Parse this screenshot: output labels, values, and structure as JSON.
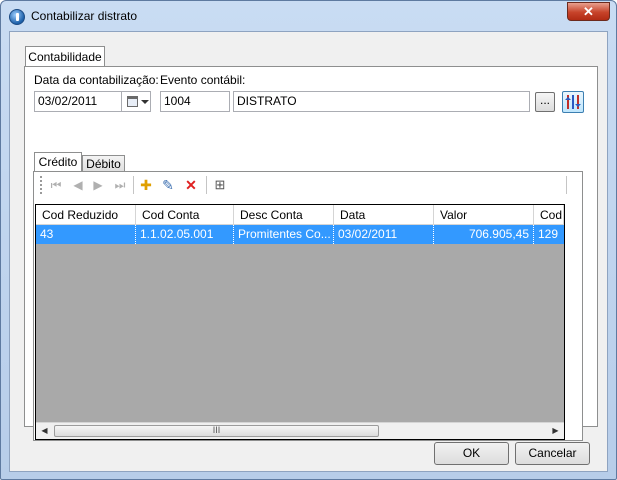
{
  "window": {
    "title": "Contabilizar distrato",
    "close_glyph": "✕"
  },
  "outer_tab": {
    "label": "Contabilidade"
  },
  "form": {
    "date_label": "Data da contabilização:",
    "date_value": "03/02/2011",
    "event_label": "Evento contábil:",
    "event_code": "1004",
    "event_desc": "DISTRATO",
    "lookup_label": "...",
    "lookup_icon": "ellipsis-icon",
    "tool_icon": "columns-settings-icon"
  },
  "tabs": [
    {
      "label": "Crédito",
      "active": true
    },
    {
      "label": "Débito",
      "active": false
    }
  ],
  "toolbar": {
    "first": "⏮",
    "prev": "◀",
    "next": "▶",
    "last": "⏭",
    "add": "✚",
    "edit": "✎",
    "delete": "✕",
    "tree": "⊞"
  },
  "grid": {
    "columns": [
      "Cod Reduzido",
      "Cod Conta",
      "Desc Conta",
      "Data",
      "Valor",
      "Cod H"
    ],
    "rows": [
      [
        "43",
        "1.1.02.05.001",
        "Promitentes Co...",
        "03/02/2011",
        "706.905,45",
        "129"
      ]
    ],
    "scroll_left": "◀",
    "scroll_right": "▶",
    "scroll_grip": "III"
  },
  "buttons": {
    "ok": "OK",
    "cancel": "Cancelar"
  },
  "colors": {
    "selection": "#3399ff",
    "grid_empty": "#a9a9a9"
  }
}
